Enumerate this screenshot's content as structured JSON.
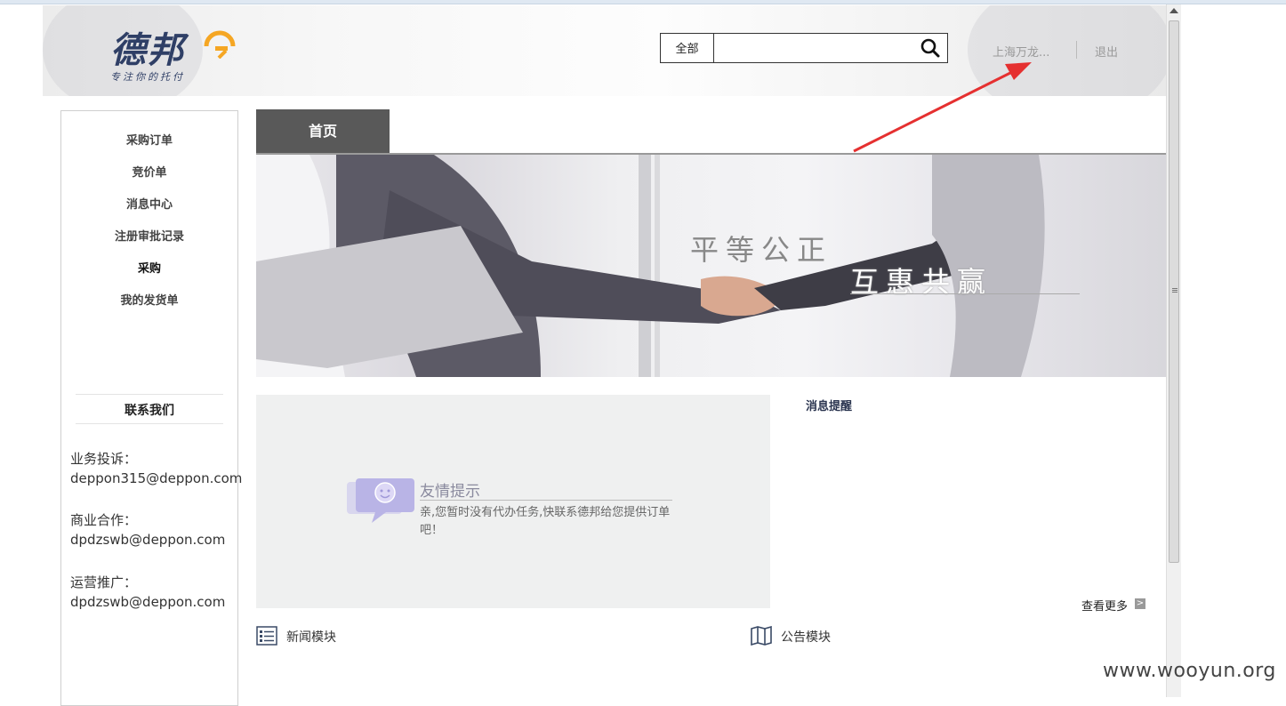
{
  "header": {
    "brand": "德邦",
    "slogan": "专注你的托付",
    "search": {
      "scope": "全部",
      "value": ""
    },
    "user": "上海万龙...",
    "logout": "退出"
  },
  "sidebar": {
    "items": [
      {
        "label": "采购订单"
      },
      {
        "label": "竞价单"
      },
      {
        "label": "消息中心"
      },
      {
        "label": "注册审批记录"
      },
      {
        "label": "采购"
      },
      {
        "label": "我的发货单"
      }
    ],
    "contact_title": "联系我们",
    "contacts": [
      {
        "label": "业务投诉：",
        "email": "deppon315@deppon.com"
      },
      {
        "label": "商业合作：",
        "email": "dpdzswb@deppon.com"
      },
      {
        "label": "运营推广：",
        "email": "dpdzswb@deppon.com"
      }
    ]
  },
  "main": {
    "tab": "首页",
    "banner": {
      "line1": "平等公正",
      "line2": "互惠共赢"
    },
    "tip": {
      "title": "友情提示",
      "text": "亲,您暂时没有代办任务,快联系德邦给您提供订单吧！"
    },
    "message_title": "消息提醒",
    "more": "查看更多",
    "modules": [
      {
        "label": "新闻模块",
        "icon": "list-icon"
      },
      {
        "label": "公告模块",
        "icon": "map-icon"
      }
    ]
  },
  "watermark": "www.wooyun.org",
  "colors": {
    "tab_bg": "#595959",
    "brand": "#2f3f66",
    "accent": "#f5a623",
    "arrow": "#e53030"
  }
}
